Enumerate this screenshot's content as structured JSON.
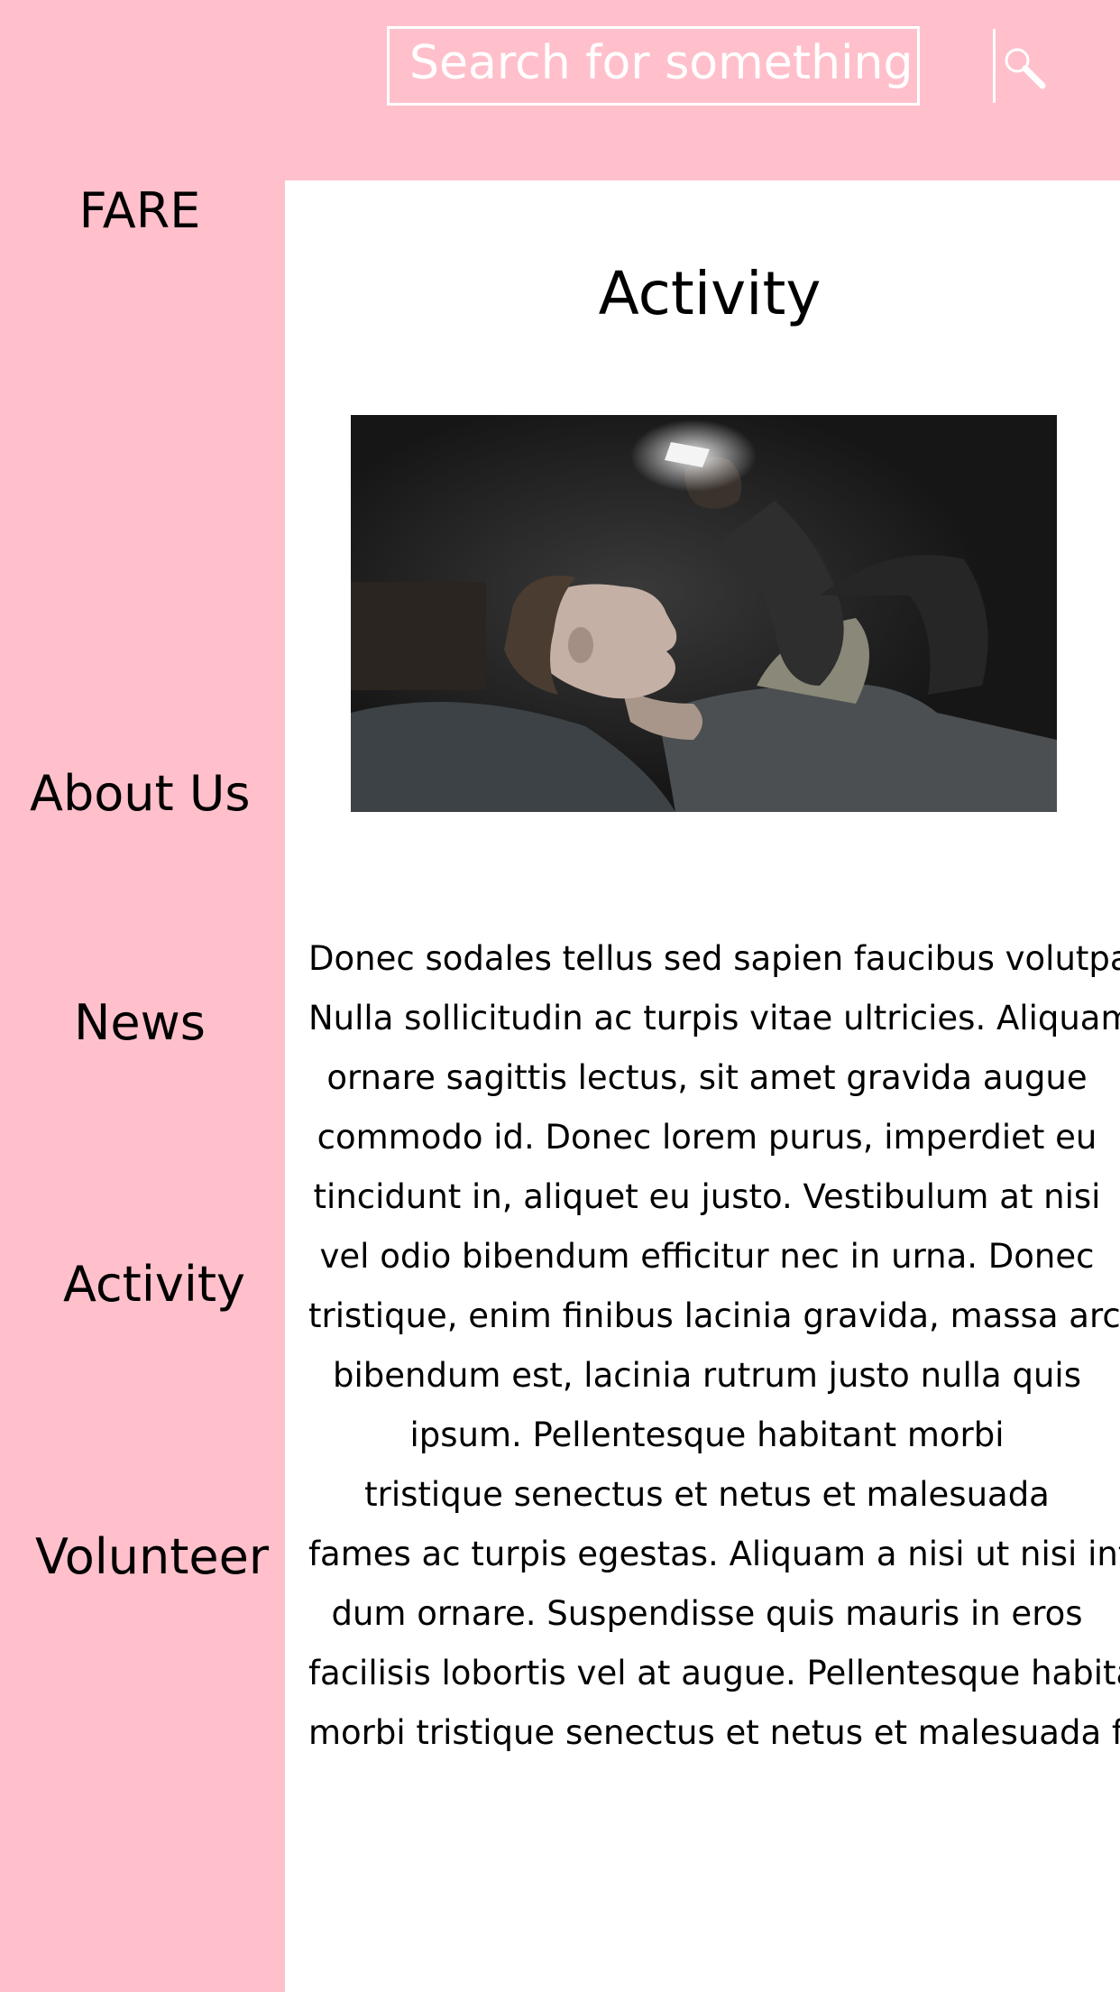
{
  "search": {
    "placeholder": "Search for something",
    "button_icon": "magnifier-icon"
  },
  "sidebar": {
    "brand": "FARE",
    "items": [
      {
        "label": "About Us"
      },
      {
        "label": "News"
      },
      {
        "label": "Activity"
      },
      {
        "label": "Volunteer"
      }
    ]
  },
  "main": {
    "title": "Activity",
    "image_description_icon": "photo-person-using-phone-in-dark",
    "paragraph_lines": [
      "Donec sodales tellus sed sapien faucibus volutpat.",
      "Nulla sollicitudin ac turpis vitae ultricies. Aliquam",
      "ornare sagittis lectus, sit amet gravida augue",
      "commodo id. Donec lorem purus, imperdiet eu",
      "tincidunt in, aliquet eu justo. Vestibulum at nisi",
      "vel odio bibendum efficitur nec in urna. Donec",
      "tristique, enim finibus lacinia gravida, massa arcu",
      "bibendum est, lacinia rutrum justo nulla quis",
      "ipsum. Pellentesque habitant morbi",
      "tristique senectus et netus et malesuada",
      "fames ac turpis egestas. Aliquam a nisi ut nisi inter-",
      "dum ornare. Suspendisse quis mauris in eros",
      "facilisis lobortis vel at augue. Pellentesque habitant",
      "morbi tristique senectus et netus et malesuada fa"
    ]
  },
  "colors": {
    "sidebar_bg": "#ffc0cb",
    "main_bg": "#ffffff",
    "search_border": "#ffffff",
    "text": "#000000"
  }
}
